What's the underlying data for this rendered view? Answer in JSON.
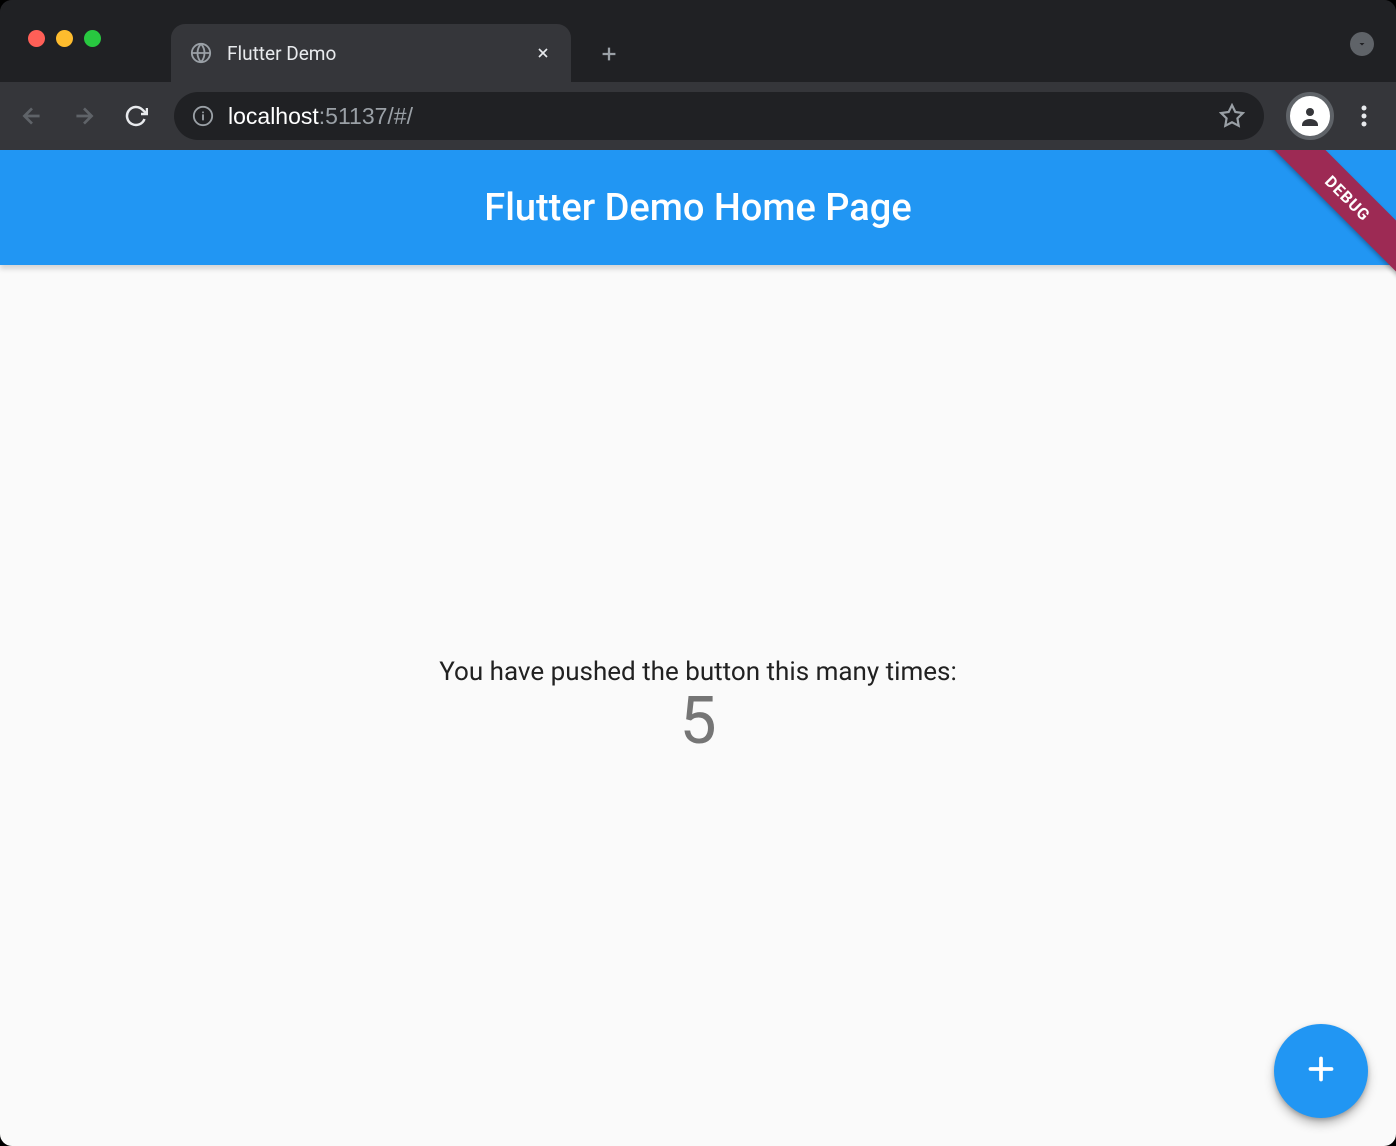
{
  "browser": {
    "tab": {
      "title": "Flutter Demo"
    },
    "url": {
      "host": "localhost",
      "rest": ":51137/#/"
    }
  },
  "app": {
    "appbar_title": "Flutter Demo Home Page",
    "debug_label": "DEBUG",
    "body": {
      "caption": "You have pushed the button this many times:",
      "counter": "5"
    },
    "colors": {
      "primary": "#2196f3",
      "scaffold": "#fafafa"
    }
  }
}
